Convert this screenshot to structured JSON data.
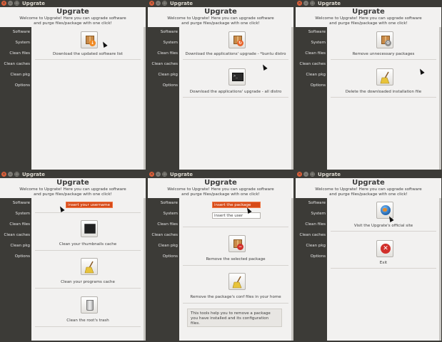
{
  "app": {
    "window_title": "Upgrate",
    "title": "Upgrate",
    "welcome_line1": "Welcome to Upgrate! Here you can upgrade software",
    "welcome_line2": "and purge files/package with one click!"
  },
  "sidebar": {
    "items": [
      {
        "label": "Software"
      },
      {
        "label": "System"
      },
      {
        "label": "Clean files"
      },
      {
        "label": "Clean caches"
      },
      {
        "label": "Clean pkg"
      },
      {
        "label": "Options"
      }
    ]
  },
  "panels": {
    "software": {
      "download_list": "Download the updated software list"
    },
    "system": {
      "download_ubuntu_upgrade": "Download the applications' upgrade - *buntu distro",
      "download_all_upgrade": "Download the applications' upgrade - all distro"
    },
    "clean_files": {
      "remove_packages": "Remove unnecessary packages",
      "delete_installation": "Delete the downloaded installation file"
    },
    "clean_caches": {
      "username_placeholder": "insert your username",
      "thumbnails": "Clean your thumbnails cache",
      "programs": "Clean your programs cache",
      "root_trash": "Clean the root's trash"
    },
    "clean_pkg": {
      "package_placeholder": "insert the package",
      "user_placeholder": "insert the user",
      "remove_package": "Remove the selected package",
      "remove_conf": "Remove the package's conf files in your home",
      "info_line1": "This tools help you to remove a package",
      "info_line2": "you have installed and its configuration files."
    },
    "options": {
      "visit_site": "Visit the Upgrate's official site",
      "exit": "Exit"
    }
  },
  "colors": {
    "sidebar_bg": "#3c3b37",
    "content_bg": "#f2f1f0",
    "focus_input": "#d74a18",
    "close_button": "#e0603a"
  },
  "icons": [
    "download-box-icon",
    "terminal-icon",
    "gear-box-icon",
    "broom-icon",
    "tv-icon",
    "trash-icon",
    "remove-box-icon",
    "globe-icon",
    "exit-icon"
  ]
}
